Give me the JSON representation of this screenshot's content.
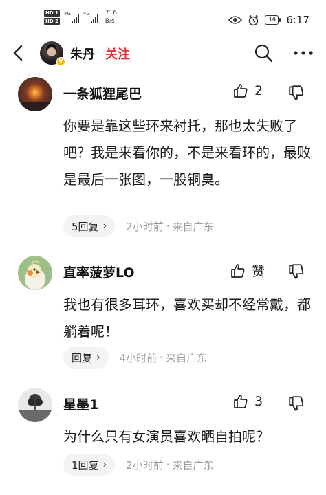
{
  "status_bar": {
    "hd1": "HD 1",
    "hd2": "HD 2",
    "net1": "4G",
    "net2": "4G",
    "speed_value": "716",
    "speed_unit": "B/s",
    "battery": "34",
    "time": "6:17"
  },
  "topbar": {
    "username": "朱丹",
    "follow_label": "关注"
  },
  "comments": [
    {
      "name": "一条狐狸尾巴",
      "likes": "2",
      "text": "你要是靠这些环来衬托，那也太失败了吧？我是来看你的，不是来看环的，最败是最后一张图，一股铜臭。",
      "reply_label": "5回复",
      "time": "2小时前",
      "location": "来自广东"
    },
    {
      "name": "直率菠萝LO",
      "likes": "赞",
      "text": "我也有很多耳环，喜欢买却不经常戴，都躺着呢！",
      "reply_label": "回复",
      "time": "4小时前",
      "location": "来自广东"
    },
    {
      "name": "星墨1",
      "likes": "3",
      "text": "为什么只有女演员喜欢晒自拍呢？",
      "reply_label": "1回复",
      "time": "2小时前",
      "location": "来自广东"
    }
  ]
}
